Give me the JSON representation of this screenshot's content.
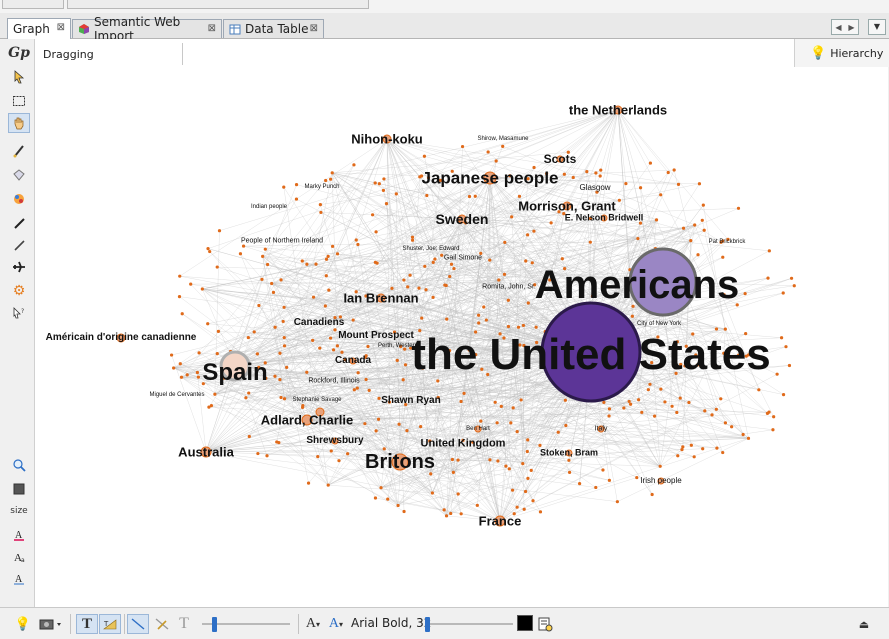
{
  "window": {
    "tabs": [
      {
        "label": "Graph",
        "active": true,
        "icon": "graph-tab-icon"
      },
      {
        "label": "Semantic Web Import",
        "active": false,
        "icon": "semantic-web-icon"
      },
      {
        "label": "Data Table",
        "active": false,
        "icon": "data-table-icon"
      }
    ],
    "tab_close": "⊠"
  },
  "toolbar_status": "Dragging",
  "hierarchy_label": "Hierarchy",
  "left_tools": [
    {
      "icon": "gephi-logo-icon"
    },
    {
      "icon": "select-arrow-icon"
    },
    {
      "icon": "rectangle-select-icon"
    },
    {
      "icon": "drag-hand-icon",
      "selected": true
    },
    {
      "icon": "painter-brush-icon"
    },
    {
      "icon": "diamond-icon"
    },
    {
      "icon": "heat-map-icon"
    },
    {
      "icon": "pencil-icon"
    },
    {
      "icon": "edge-pencil-icon"
    },
    {
      "icon": "airplane-icon"
    },
    {
      "icon": "gear-icon"
    },
    {
      "icon": "cursor-help-icon"
    }
  ],
  "left_lower_tools": [
    {
      "icon": "zoom-icon"
    },
    {
      "icon": "square-icon"
    },
    {
      "icon": "size-text",
      "text": "size"
    },
    {
      "icon": "text-color-icon"
    },
    {
      "icon": "text-font-icon"
    },
    {
      "icon": "text-underline-icon"
    }
  ],
  "graph": {
    "edge_color": "#bdbdbd",
    "node_color": "#e06a1a",
    "big_node_colors": {
      "united_states": "#5c3597",
      "americans": "#9a86c4",
      "spain": "#f4d6c7"
    },
    "labels": [
      {
        "text": "the Netherlands",
        "size": 13
      },
      {
        "text": "Nihon-koku",
        "size": 13
      },
      {
        "text": "Shirow, Masamune",
        "size": 6
      },
      {
        "text": "Scots",
        "size": 12
      },
      {
        "text": "Japanese people",
        "size": 17
      },
      {
        "text": "Glasgow",
        "size": 8
      },
      {
        "text": "Morrison, Grant",
        "size": 13
      },
      {
        "text": "Marky Punch",
        "size": 6
      },
      {
        "text": "Indian people",
        "size": 6
      },
      {
        "text": "Sweden",
        "size": 14
      },
      {
        "text": "E. Nelson Bridwell",
        "size": 9
      },
      {
        "text": "People of Northern Ireland",
        "size": 7
      },
      {
        "text": "Shuster, Joe; Edward",
        "size": 6
      },
      {
        "text": "Gail Simone",
        "size": 7
      },
      {
        "text": "Pat Brickbrick",
        "size": 6
      },
      {
        "text": "Americans",
        "size": 40
      },
      {
        "text": "Romita, John, Sr.",
        "size": 7
      },
      {
        "text": "Ian Brennan",
        "size": 13
      },
      {
        "text": "Canadiens",
        "size": 10
      },
      {
        "text": "City of New York",
        "size": 6
      },
      {
        "text": "Américain d'origine canadienne",
        "size": 10
      },
      {
        "text": "Mount Prospect",
        "size": 10
      },
      {
        "text": "Perth, Western",
        "size": 6
      },
      {
        "text": "the United States",
        "size": 44
      },
      {
        "text": "Canada",
        "size": 10
      },
      {
        "text": "Spain",
        "size": 24
      },
      {
        "text": "Rockford, Illinois",
        "size": 7
      },
      {
        "text": "Miguel de Cervantes",
        "size": 6
      },
      {
        "text": "Stephanie Savage",
        "size": 6
      },
      {
        "text": "Shawn Ryan",
        "size": 10
      },
      {
        "text": "Adlard, Charlie",
        "size": 13
      },
      {
        "text": "Ben Hart",
        "size": 6
      },
      {
        "text": "Italy",
        "size": 7
      },
      {
        "text": "Shrewsbury",
        "size": 10
      },
      {
        "text": "United Kingdom",
        "size": 11
      },
      {
        "text": "Australia",
        "size": 13
      },
      {
        "text": "Stoken, Bram",
        "size": 9
      },
      {
        "text": "Britons",
        "size": 20
      },
      {
        "text": "Irish people",
        "size": 8
      },
      {
        "text": "France",
        "size": 13
      }
    ]
  },
  "bottom_bar": {
    "font_label": "Arial Bold, 32",
    "text_color": "#000000",
    "icons": [
      "lightbulb-icon",
      "screenshot-icon",
      "text-toggle-icon",
      "text-size-icon",
      "edge-line-icon",
      "edge-select-icon",
      "text-fit-icon",
      "font-smaller-icon",
      "font-color-icon",
      "settings-icon",
      "collapse-icon"
    ]
  }
}
